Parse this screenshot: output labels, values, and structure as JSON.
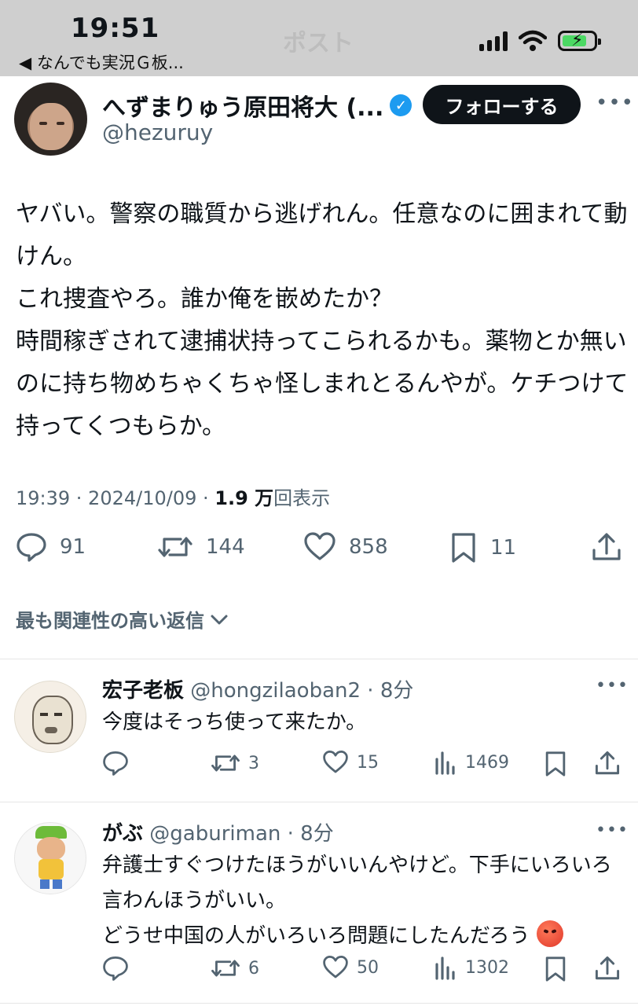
{
  "status_bar": {
    "time": "19:51",
    "back_label": "◀ なんでも実況Ｇ板...",
    "ghost_title": "ポスト"
  },
  "post": {
    "author_name": "へずまりゅう原田将大 (...",
    "handle": "@hezuruy",
    "follow_label": "フォローする",
    "body": "ヤバい。警察の職質から逃げれん。任意なのに囲まれて動けん。\nこれ捜査やろ。誰か俺を嵌めたか？\n時間稼ぎされて逮捕状持ってこられるかも。薬物とか無いのに持ち物めちゃくちゃ怪しまれとるんやが。ケチつけて持ってくつもらか。",
    "time": "19:39 · 2024/10/09 · ",
    "views": "1.9 万",
    "views_suffix": "回表示",
    "replies": "91",
    "reposts": "144",
    "likes": "858",
    "bookmarks": "11"
  },
  "sort_label": "最も関連性の高い返信",
  "replies": [
    {
      "name": "宏子老板",
      "handle": "@hongzilaoban2",
      "age": " · 8分",
      "text": "今度はそっち使って来たか。",
      "replies": "",
      "reposts": "3",
      "likes": "15",
      "views": "1469"
    },
    {
      "name": "がぶ",
      "handle": "@gaburiman",
      "age": " · 8分",
      "text": "弁護士すぐつけたほうがいいんやけど。下手にいろいろ言わんほうがいい。\nどうせ中国の人がいろいろ問題にしたんだろう",
      "replies": "",
      "reposts": "6",
      "likes": "50",
      "views": "1302"
    }
  ],
  "colors": {
    "accent": "#1d9bf0",
    "text": "#0f1419",
    "muted": "#536471",
    "status_bar": "#cfcfcf"
  }
}
